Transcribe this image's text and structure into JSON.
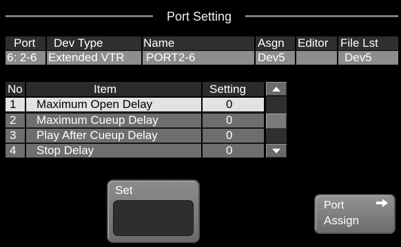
{
  "title": "Port Setting",
  "port_table": {
    "headers": [
      "Port",
      "Dev Type",
      "Name",
      "Asgn",
      "Editor",
      "File Lst"
    ],
    "row": [
      "6: 2-6",
      "Extended VTR",
      "PORT2-6",
      "Dev5",
      "",
      "Dev5"
    ]
  },
  "list": {
    "headers": [
      "No",
      "Item",
      "Setting"
    ],
    "rows": [
      [
        "1",
        "Maximum Open Delay",
        "0"
      ],
      [
        "2",
        "Maximum Cueup Delay",
        "0"
      ],
      [
        "3",
        "Play After Cueup Delay",
        "0"
      ],
      [
        "4",
        "Stop Delay",
        "0"
      ]
    ],
    "selected_row": 1
  },
  "buttons": {
    "set_label": "Set",
    "port_assign_line1": "Port",
    "port_assign_line2": "Assign"
  },
  "icons": {
    "scroll_up": "up-triangle-icon",
    "scroll_down": "down-triangle-icon",
    "assign_arrow": "right-arrow-icon"
  }
}
